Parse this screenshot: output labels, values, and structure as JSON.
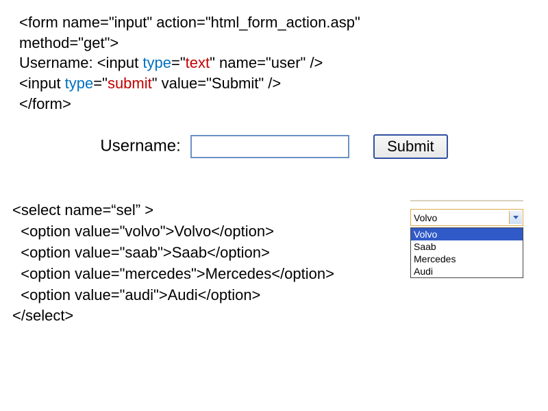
{
  "code1": {
    "l1a": "<form name=\"input\" action=\"html_form_action.asp\"",
    "l1b": "method=\"get\">",
    "l2a": "Username: <input ",
    "l2_type": "type",
    "l2_eq": "=\"",
    "l2_val": "text",
    "l2_end": "\" name=\"user\" />",
    "l3a": "<input ",
    "l3_val": "submit",
    "l3_end": "\" value=\"Submit\" />",
    "l4": "</form>"
  },
  "demo": {
    "label": "Username:",
    "placeholder": "",
    "submit": "Submit"
  },
  "code2": {
    "l1": "<select name=“sel” >",
    "l2": "  <option value=\"volvo\">Volvo</option>",
    "l3": "  <option value=\"saab\">Saab</option>",
    "l4": "  <option value=\"mercedes\">Mercedes</option>",
    "l5": "  <option value=\"audi\">Audi</option>",
    "l6": "</select>"
  },
  "select": {
    "closed": "Volvo",
    "options": [
      "Volvo",
      "Saab",
      "Mercedes",
      "Audi"
    ]
  }
}
